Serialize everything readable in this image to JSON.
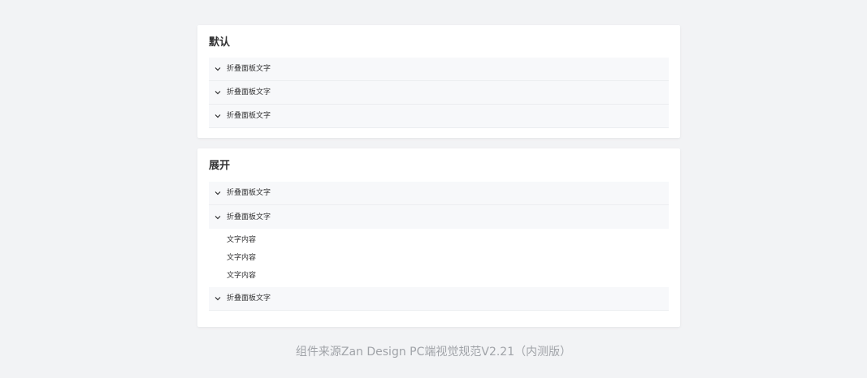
{
  "sections": [
    {
      "title": "默认",
      "panels": [
        {
          "title": "折叠面板文字"
        },
        {
          "title": "折叠面板文字"
        },
        {
          "title": "折叠面板文字"
        }
      ]
    },
    {
      "title": "展开",
      "panels": [
        {
          "title": "折叠面板文字"
        },
        {
          "title": "折叠面板文字",
          "expanded": true,
          "content": [
            "文字内容",
            "文字内容",
            "文字内容"
          ]
        },
        {
          "title": "折叠面板文字"
        }
      ]
    }
  ],
  "footer": "组件来源Zan Design PC端视觉规范V2.21（内测版）",
  "icons": {
    "panel_toggle": "chevron-down-icon"
  },
  "colors": {
    "page_background": "#f2f3f5",
    "card_background": "#ffffff",
    "panel_header_background": "#f7f8fa",
    "text": "#323233",
    "footer_text": "#a0a3a8"
  }
}
